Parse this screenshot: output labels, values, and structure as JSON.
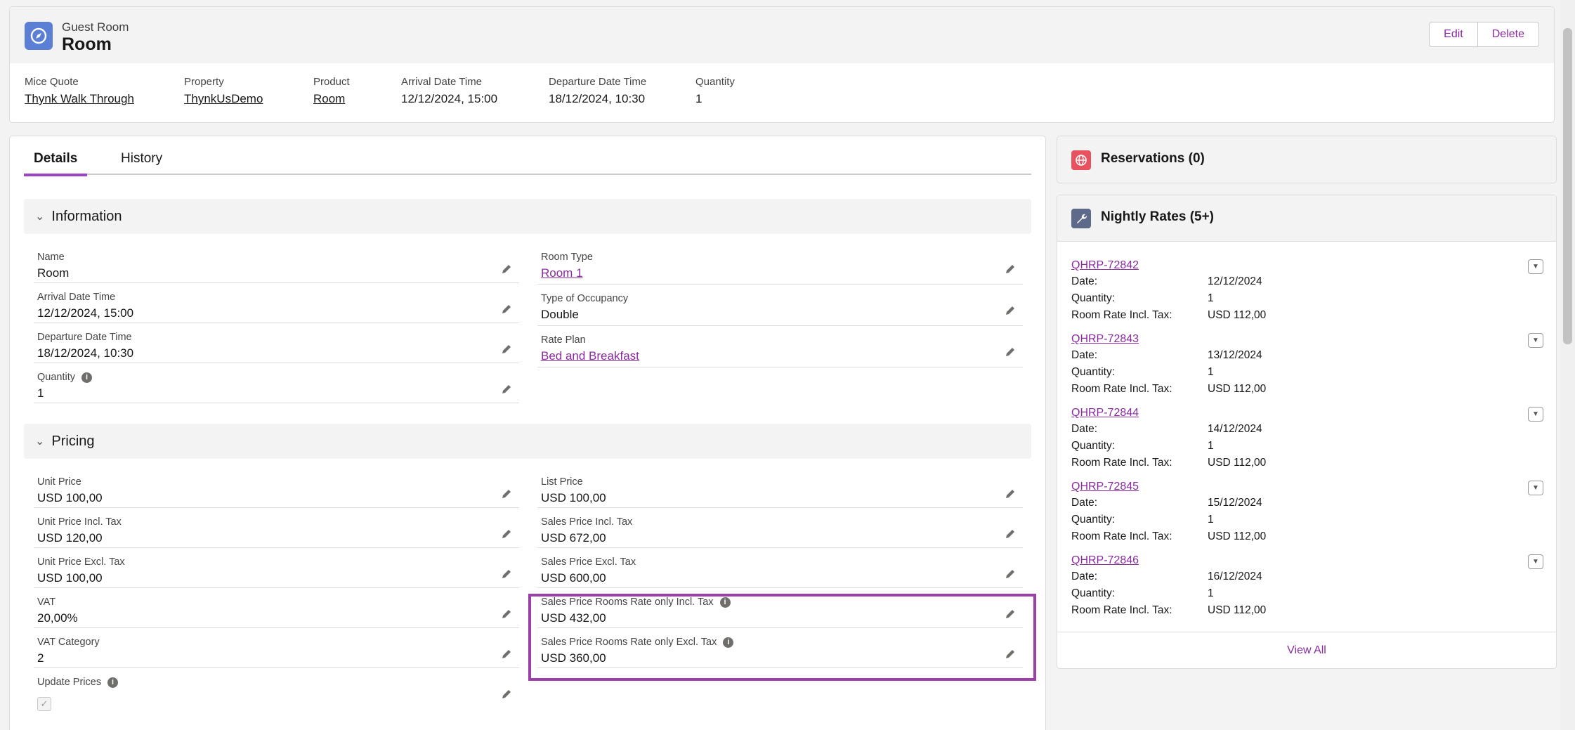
{
  "header": {
    "object_label": "Guest Room",
    "record_name": "Room",
    "edit_label": "Edit",
    "delete_label": "Delete",
    "fields": [
      {
        "label": "Mice Quote",
        "value": "Thynk Walk Through",
        "link": true
      },
      {
        "label": "Property",
        "value": "ThynkUsDemo",
        "link": true
      },
      {
        "label": "Product",
        "value": "Room",
        "link": true
      },
      {
        "label": "Arrival Date Time",
        "value": "12/12/2024, 15:00",
        "link": false
      },
      {
        "label": "Departure Date Time",
        "value": "18/12/2024, 10:30",
        "link": false
      },
      {
        "label": "Quantity",
        "value": "1",
        "link": false
      }
    ]
  },
  "tabs": {
    "details": "Details",
    "history": "History"
  },
  "information": {
    "title": "Information",
    "left": [
      {
        "label": "Name",
        "value": "Room"
      },
      {
        "label": "Arrival Date Time",
        "value": "12/12/2024, 15:00"
      },
      {
        "label": "Departure Date Time",
        "value": "18/12/2024, 10:30"
      },
      {
        "label": "Quantity",
        "value": "1"
      }
    ],
    "right": [
      {
        "label": "Room Type",
        "value": "Room 1"
      },
      {
        "label": "Type of Occupancy",
        "value": "Double"
      },
      {
        "label": "Rate Plan",
        "value": "Bed and Breakfast"
      }
    ]
  },
  "pricing": {
    "title": "Pricing",
    "left": [
      {
        "label": "Unit Price",
        "value": "USD 100,00"
      },
      {
        "label": "Unit Price Incl. Tax",
        "value": "USD 120,00"
      },
      {
        "label": "Unit Price Excl. Tax",
        "value": "USD 100,00"
      },
      {
        "label": "VAT",
        "value": "20,00%"
      },
      {
        "label": "VAT Category",
        "value": "2"
      },
      {
        "label": "Update Prices",
        "value": ""
      }
    ],
    "right": [
      {
        "label": "List Price",
        "value": "USD 100,00"
      },
      {
        "label": "Sales Price Incl. Tax",
        "value": "USD 672,00"
      },
      {
        "label": "Sales Price Excl. Tax",
        "value": "USD 600,00"
      },
      {
        "label": "Sales Price Rooms Rate only Incl. Tax",
        "value": "USD 432,00"
      },
      {
        "label": "Sales Price Rooms Rate only Excl. Tax",
        "value": "USD 360,00"
      }
    ]
  },
  "reservations": {
    "title": "Reservations (0)"
  },
  "nightly_rates": {
    "title": "Nightly Rates (5+)",
    "date_label": "Date:",
    "quantity_label": "Quantity:",
    "rate_label": "Room Rate Incl. Tax:",
    "items": [
      {
        "code": "QHRP-72842",
        "date": "12/12/2024",
        "quantity": "1",
        "rate": "USD 112,00"
      },
      {
        "code": "QHRP-72843",
        "date": "13/12/2024",
        "quantity": "1",
        "rate": "USD 112,00"
      },
      {
        "code": "QHRP-72844",
        "date": "14/12/2024",
        "quantity": "1",
        "rate": "USD 112,00"
      },
      {
        "code": "QHRP-72845",
        "date": "15/12/2024",
        "quantity": "1",
        "rate": "USD 112,00"
      },
      {
        "code": "QHRP-72846",
        "date": "16/12/2024",
        "quantity": "1",
        "rate": "USD 112,00"
      }
    ],
    "view_all": "View All"
  },
  "colors": {
    "accent": "#8a2ba0",
    "highlight": "#9b3ea8",
    "header_icon": "#5c7fd6",
    "reservations_icon": "#e8515e",
    "nightly_icon": "#5e6a8a"
  }
}
